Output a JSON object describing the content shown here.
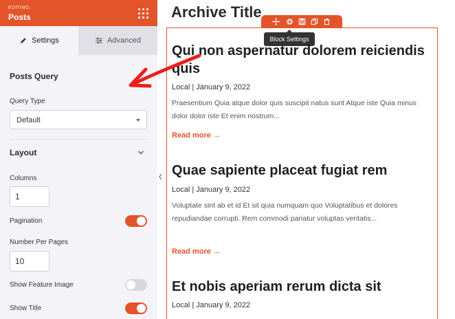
{
  "sidebar": {
    "editing_label": "EDITING:",
    "title": "Posts",
    "tabs": {
      "settings": "Settings",
      "advanced": "Advanced"
    },
    "posts_query": {
      "heading": "Posts Query",
      "query_type_label": "Query Type",
      "query_type_value": "Default"
    },
    "layout": {
      "heading": "Layout",
      "columns_label": "Columns",
      "columns_value": "1",
      "pagination_label": "Pagination",
      "pagination_on": true,
      "number_per_pages_label": "Number Per Pages",
      "number_per_pages_value": "10",
      "show_feature_image_label": "Show Feature Image",
      "show_feature_image_on": false,
      "show_title_label": "Show Title",
      "show_title_on": true
    }
  },
  "block_toolbar": {
    "icons": [
      "move-icon",
      "gear-icon",
      "save-icon",
      "duplicate-icon",
      "trash-icon"
    ],
    "tooltip": "Block Settings"
  },
  "content": {
    "archive_title": "Archive Title",
    "posts": [
      {
        "title": "Qui non aspernatur dolorem reiciendis quis",
        "meta": "Local | January 9, 2022",
        "excerpt": "Praesentium Quia atque dolor quis suscipit natus sunt Atque iste Quia minus dolor dolor iste Et enim nostrum...",
        "read_more": "Read more →"
      },
      {
        "title": "Quae sapiente placeat fugiat rem",
        "meta": "Local | January 9, 2022",
        "excerpt": "Voluptate sint ab et id Et sit quia numquam quo Voluptatibus et dolores repudiandae corrupti. Rem commodi pariatur voluptas veritatis...",
        "read_more": "Read more →"
      },
      {
        "title": "Et nobis aperiam rerum dicta sit",
        "meta": "Local | January 9, 2022"
      }
    ]
  },
  "colors": {
    "accent": "#e4542a",
    "sidebar_bg": "#f4f3f8",
    "tab_inactive_bg": "#e1e0e6",
    "annotation_arrow": "#e8211b"
  }
}
